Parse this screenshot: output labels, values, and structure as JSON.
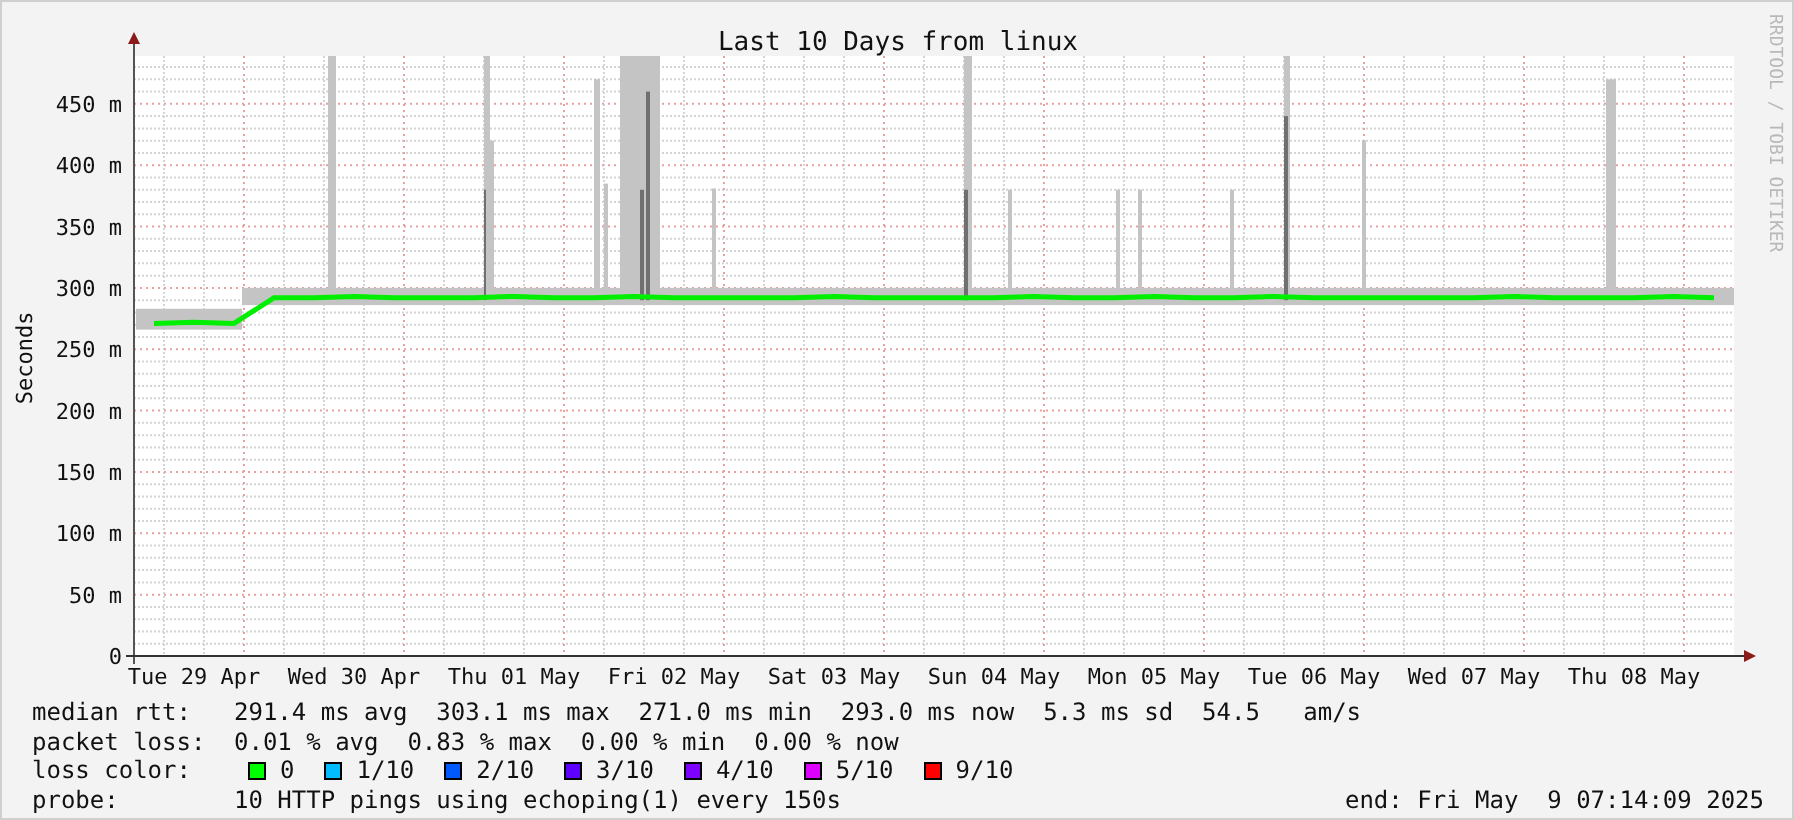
{
  "graph": {
    "chart_data": {
      "type": "line",
      "grid": true,
      "title": "Last 10 Days from linux",
      "ylabel": "Seconds",
      "ylim": [
        0,
        489
      ],
      "categories": [
        null,
        "Tue 29 Apr",
        null,
        null,
        null,
        "Wed 30 Apr",
        null,
        null,
        null,
        "Thu 01 May",
        null,
        null,
        null,
        "Fri 02 May",
        null,
        null,
        null,
        "Sat 03 May",
        null,
        null,
        null,
        "Sun 04 May",
        null,
        null,
        null,
        "Mon 05 May",
        null,
        null,
        null,
        "Tue 06 May",
        null,
        null,
        null,
        "Wed 07 May",
        null,
        null,
        null,
        "Thu 08 May",
        null,
        null
      ],
      "yticks": [
        {
          "value": 0,
          "label": "0"
        },
        {
          "value": 50,
          "label": "50 m"
        },
        {
          "value": 100,
          "label": "100 m"
        },
        {
          "value": 150,
          "label": "150 m"
        },
        {
          "value": 200,
          "label": "200 m"
        },
        {
          "value": 250,
          "label": "250 m"
        },
        {
          "value": 300,
          "label": "300 m"
        },
        {
          "value": 350,
          "label": "350 m"
        },
        {
          "value": 400,
          "label": "400 m"
        },
        {
          "value": 450,
          "label": "450 m"
        }
      ],
      "series": [
        {
          "name": "median rtt:",
          "color": "#00ee00",
          "values": [
            271,
            272,
            271,
            292,
            292,
            293,
            292,
            292,
            292,
            293,
            292,
            292,
            293,
            292,
            292,
            292,
            292,
            293,
            292,
            292,
            292,
            292,
            293,
            292,
            292,
            293,
            292,
            292,
            293,
            292,
            292,
            292,
            292,
            292,
            293,
            292,
            292,
            292,
            293,
            292
          ]
        }
      ]
    },
    "watermark": "RRDTOOL / TOBI OETIKER"
  },
  "legend": [
    {
      "text": "291.4 ms avg  303.1 ms max  271.0 ms min  293.0 ms now  5.3 ms sd  54.5   am/s"
    },
    {
      "label": "packet loss:",
      "text": "0.01 % avg  0.83 % max  0.00 % min  0.00 % now"
    }
  ],
  "loss_color": {
    "label": "loss color:",
    "items": [
      {
        "label": "0",
        "color": "#00ff00"
      },
      {
        "label": "1/10",
        "color": "#00bbff"
      },
      {
        "label": "2/10",
        "color": "#0059ff"
      },
      {
        "label": "3/10",
        "color": "#5e00ff"
      },
      {
        "label": "4/10",
        "color": "#7e00ff"
      },
      {
        "label": "5/10",
        "color": "#dd00ff"
      },
      {
        "label": "9/10",
        "color": "#ff0000"
      }
    ]
  },
  "probe": {
    "label": "probe:",
    "text": "10 HTTP pings using echoping(1) every 150s"
  },
  "end": "end: Fri May  9 07:14:09 2025"
}
